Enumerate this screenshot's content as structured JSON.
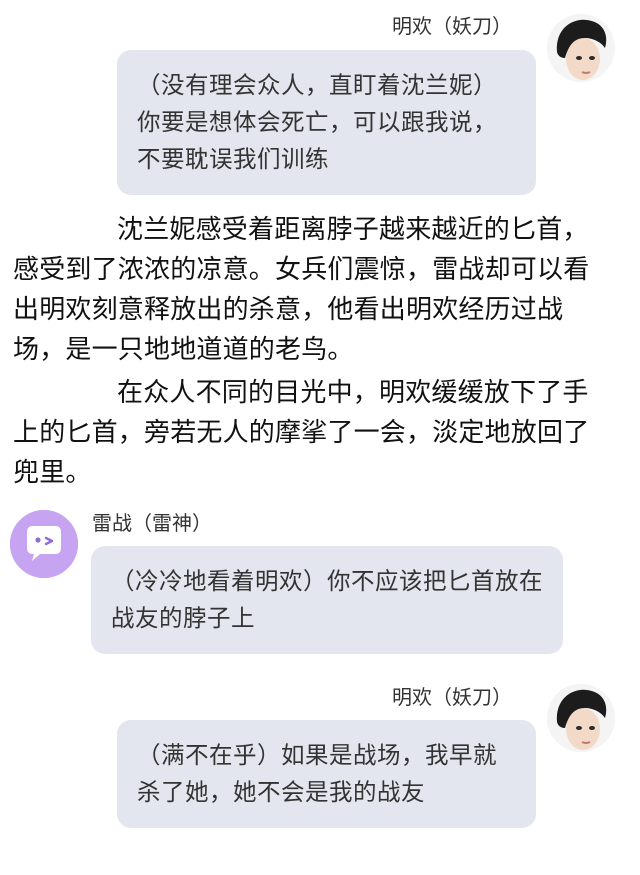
{
  "messages": [
    {
      "name": "明欢（妖刀）",
      "text": "（没有理会众人，直盯着沈兰妮）你要是想体会死亡，可以跟我说，不要耽误我们训练",
      "avatar": "portrait-photo-icon"
    },
    {
      "name": "雷战（雷神）",
      "text": "（冷冷地看着明欢）你不应该把匕首放在战友的脖子上",
      "avatar": "chat-bubble-wink-icon"
    },
    {
      "name": "明欢（妖刀）",
      "text": "（满不在乎）如果是战场，我早就杀了她，她不会是我的战友",
      "avatar": "portrait-photo-icon"
    }
  ],
  "narration": [
    "沈兰妮感受着距离脖子越来越近的匕首，感受到了浓浓的凉意。女兵们震惊，雷战却可以看出明欢刻意释放出的杀意，他看出明欢经历过战场，是一只地地道道的老鸟。",
    "在众人不同的目光中，明欢缓缓放下了手上的匕首，旁若无人的摩挲了一会，淡定地放回了兜里。"
  ],
  "colors": {
    "bubble": "#e3e6ee",
    "bot_avatar": "#c7a4f1",
    "text": "#111111"
  }
}
